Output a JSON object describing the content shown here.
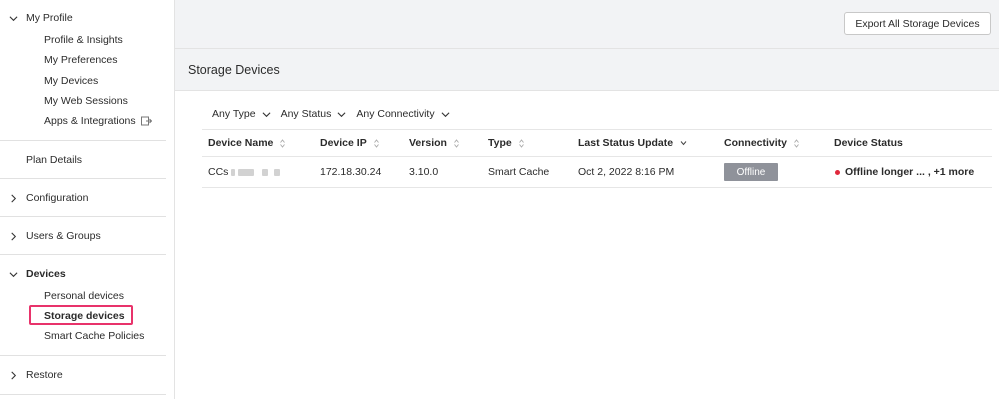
{
  "sidebar": {
    "my_profile": {
      "label": "My Profile",
      "items": [
        "Profile & Insights",
        "My Preferences",
        "My Devices",
        "My Web Sessions",
        "Apps & Integrations"
      ]
    },
    "plan_details": "Plan Details",
    "configuration": "Configuration",
    "users_groups": "Users & Groups",
    "devices": {
      "label": "Devices",
      "items": [
        "Personal devices",
        "Storage devices",
        "Smart Cache Policies"
      ],
      "active": "Storage devices"
    },
    "restore": "Restore"
  },
  "toolbar": {
    "export_label": "Export All Storage Devices"
  },
  "page": {
    "title": "Storage Devices"
  },
  "filters": [
    "Any Type",
    "Any Status",
    "Any Connectivity"
  ],
  "table": {
    "columns": [
      "Device Name",
      "Device IP",
      "Version",
      "Type",
      "Last Status Update",
      "Connectivity",
      "Device Status"
    ],
    "rows": [
      {
        "name": "CCs",
        "ip": "172.18.30.24",
        "version": "3.10.0",
        "type": "Smart Cache",
        "last_update": "Oct 2, 2022 8:16 PM",
        "connectivity": "Offline",
        "status": "Offline longer ... , +1 more"
      }
    ]
  },
  "colors": {
    "highlight": "#e8336b",
    "offline_badge": "#8f929a",
    "status_dot": "#e0283c"
  }
}
